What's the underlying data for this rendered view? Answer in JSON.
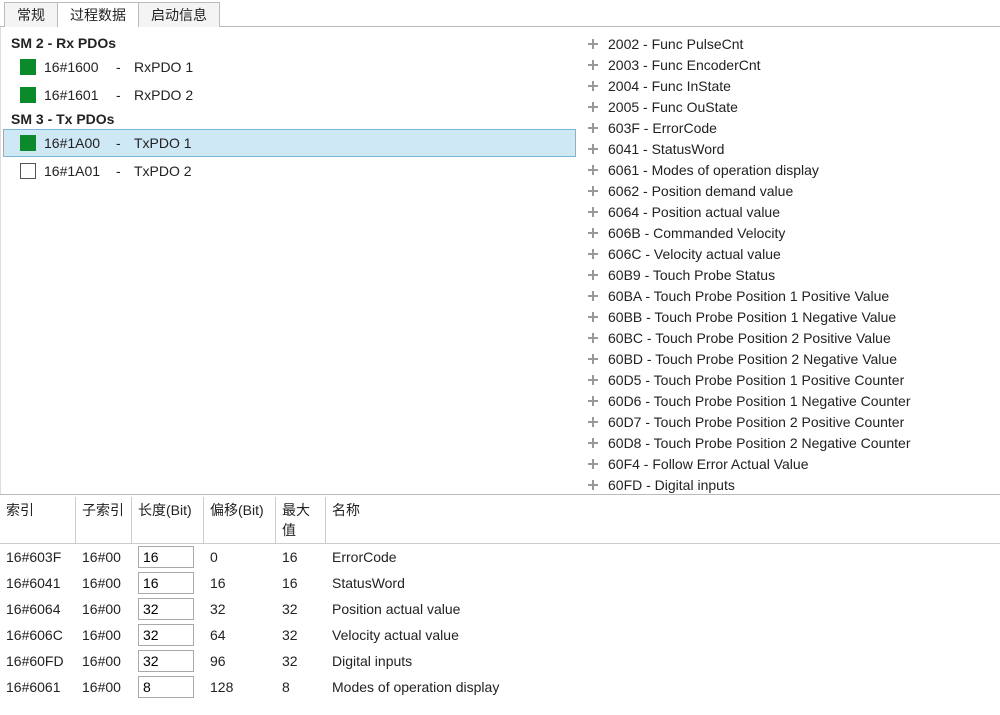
{
  "tabs": [
    {
      "label": "常规",
      "active": false
    },
    {
      "label": "过程数据",
      "active": true
    },
    {
      "label": "启动信息",
      "active": false
    }
  ],
  "pdo_groups": [
    {
      "title": "SM 2 - Rx PDOs",
      "rows": [
        {
          "index": "16#1600",
          "name": "RxPDO 1",
          "filled": true,
          "selected": false
        },
        {
          "index": "16#1601",
          "name": "RxPDO 2",
          "filled": true,
          "selected": false
        }
      ]
    },
    {
      "title": "SM 3 - Tx PDOs",
      "rows": [
        {
          "index": "16#1A00",
          "name": "TxPDO 1",
          "filled": true,
          "selected": true
        },
        {
          "index": "16#1A01",
          "name": "TxPDO 2",
          "filled": false,
          "selected": false
        }
      ]
    }
  ],
  "objects": [
    {
      "code": "2002",
      "name": "Func PulseCnt"
    },
    {
      "code": "2003",
      "name": "Func EncoderCnt"
    },
    {
      "code": "2004",
      "name": "Func InState"
    },
    {
      "code": "2005",
      "name": "Func OuState"
    },
    {
      "code": "603F",
      "name": "ErrorCode"
    },
    {
      "code": "6041",
      "name": "StatusWord"
    },
    {
      "code": "6061",
      "name": "Modes of operation display"
    },
    {
      "code": "6062",
      "name": "Position demand value"
    },
    {
      "code": "6064",
      "name": "Position actual value"
    },
    {
      "code": "606B",
      "name": "Commanded Velocity"
    },
    {
      "code": "606C",
      "name": "Velocity actual value"
    },
    {
      "code": "60B9",
      "name": "Touch Probe Status"
    },
    {
      "code": "60BA",
      "name": "Touch Probe Position 1 Positive Value"
    },
    {
      "code": "60BB",
      "name": "Touch Probe Position 1 Negative Value"
    },
    {
      "code": "60BC",
      "name": "Touch Probe Position 2 Positive Value"
    },
    {
      "code": "60BD",
      "name": "Touch Probe Position 2 Negative Value"
    },
    {
      "code": "60D5",
      "name": "Touch Probe Position 1 Positive Counter"
    },
    {
      "code": "60D6",
      "name": "Touch Probe Position 1 Negative Counter"
    },
    {
      "code": "60D7",
      "name": "Touch Probe Position 2 Positive Counter"
    },
    {
      "code": "60D8",
      "name": "Touch Probe Position 2 Negative Counter"
    },
    {
      "code": "60F4",
      "name": "Follow Error Actual Value"
    },
    {
      "code": "60FD",
      "name": "Digital inputs"
    }
  ],
  "table": {
    "headers": {
      "index": "索引",
      "sub": "子索引",
      "len": "长度(Bit)",
      "off": "偏移(Bit)",
      "max": "最大值",
      "name": "名称"
    },
    "rows": [
      {
        "index": "16#603F",
        "sub": "16#00",
        "len": "16",
        "off": "0",
        "max": "16",
        "name": "ErrorCode"
      },
      {
        "index": "16#6041",
        "sub": "16#00",
        "len": "16",
        "off": "16",
        "max": "16",
        "name": "StatusWord"
      },
      {
        "index": "16#6064",
        "sub": "16#00",
        "len": "32",
        "off": "32",
        "max": "32",
        "name": "Position actual value"
      },
      {
        "index": "16#606C",
        "sub": "16#00",
        "len": "32",
        "off": "64",
        "max": "32",
        "name": "Velocity actual value"
      },
      {
        "index": "16#60FD",
        "sub": "16#00",
        "len": "32",
        "off": "96",
        "max": "32",
        "name": "Digital inputs"
      },
      {
        "index": "16#6061",
        "sub": "16#00",
        "len": "8",
        "off": "128",
        "max": "8",
        "name": "Modes of operation display"
      }
    ]
  }
}
